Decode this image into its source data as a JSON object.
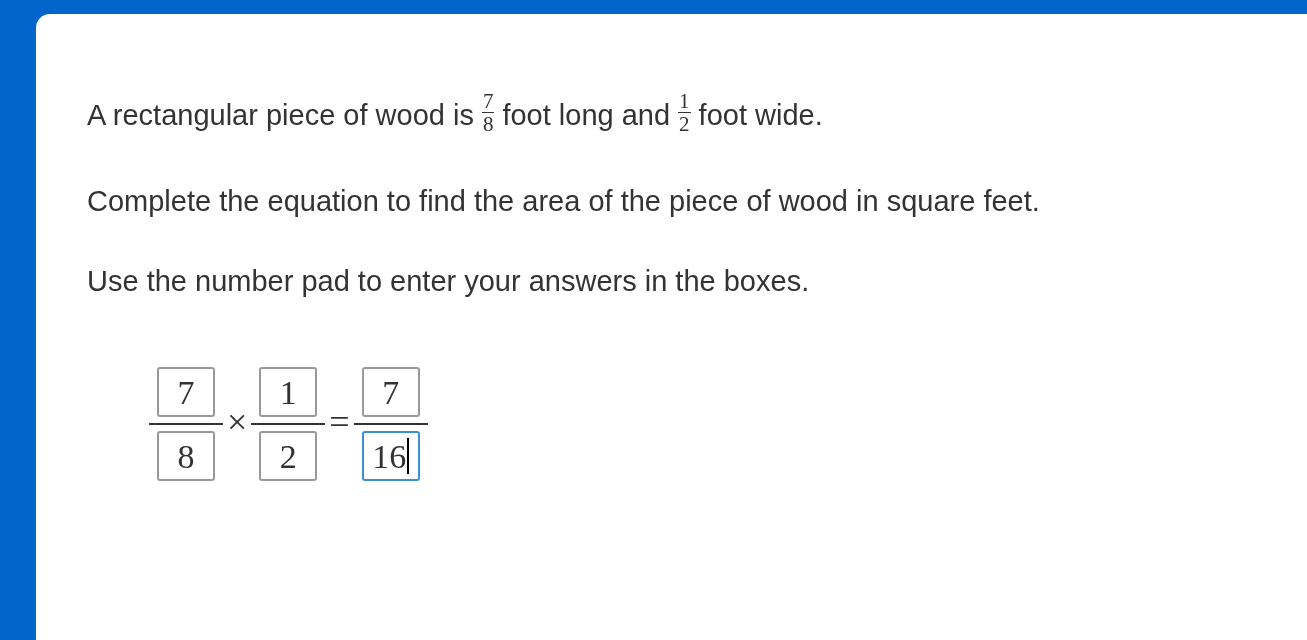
{
  "question": {
    "paragraphs": [
      {
        "parts": [
          {
            "kind": "text",
            "text": "A rectangular piece of wood is"
          },
          {
            "kind": "fraction",
            "numerator": "7",
            "denominator": "8"
          },
          {
            "kind": "text",
            "text": "foot long and"
          },
          {
            "kind": "fraction",
            "numerator": "1",
            "denominator": "2"
          },
          {
            "kind": "text",
            "text": "foot wide."
          }
        ]
      },
      {
        "parts": [
          {
            "kind": "text",
            "text": "Complete the equation to find the area of the piece of wood in square feet."
          }
        ]
      },
      {
        "parts": [
          {
            "kind": "text",
            "text": "Use the number pad to enter your answers in the boxes."
          }
        ]
      }
    ],
    "equation": [
      {
        "kind": "fraction",
        "numerator": {
          "value": "7",
          "focused": false
        },
        "denominator": {
          "value": "8",
          "focused": false
        }
      },
      {
        "kind": "operator",
        "text": "×"
      },
      {
        "kind": "fraction",
        "numerator": {
          "value": "1",
          "focused": false
        },
        "denominator": {
          "value": "2",
          "focused": false
        }
      },
      {
        "kind": "operator",
        "text": "="
      },
      {
        "kind": "fraction",
        "numerator": {
          "value": "7",
          "focused": false
        },
        "denominator": {
          "value": "16",
          "focused": true
        }
      }
    ]
  }
}
